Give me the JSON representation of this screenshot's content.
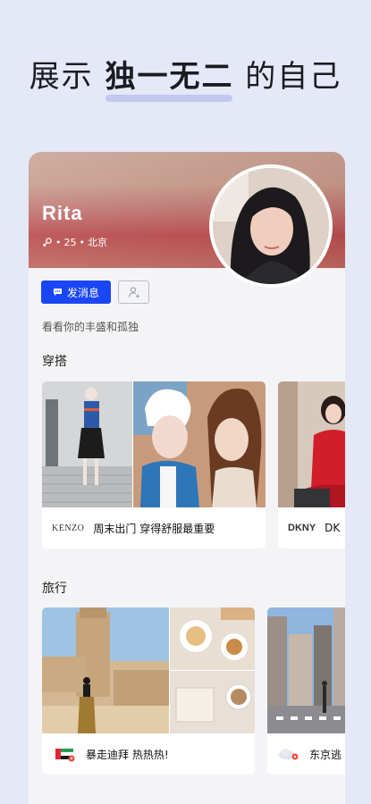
{
  "headline": {
    "before": "展示 ",
    "emphasis": "独一无二",
    "after": " 的自己"
  },
  "profile": {
    "name": "Rita",
    "age": "25",
    "city": "北京",
    "separator": "•",
    "bio": "看看你的丰盛和孤独"
  },
  "actions": {
    "message_label": "发消息"
  },
  "sections": {
    "outfit_title": "穿搭",
    "travel_title": "旅行"
  },
  "outfit_posts": [
    {
      "brand": "KENZO",
      "caption": "周末出门 穿得舒服最重要"
    },
    {
      "brand": "DKNY",
      "caption": "DK"
    }
  ],
  "travel_posts": [
    {
      "flag": "uae-flag-pin-icon",
      "caption": "暴走迪拜 热热热!"
    },
    {
      "flag": "cloud-pin-icon",
      "caption": "东京逃"
    }
  ],
  "colors": {
    "background": "#e4e8f7",
    "primary_button": "#1a46f5",
    "card": "#f4f4f6"
  }
}
